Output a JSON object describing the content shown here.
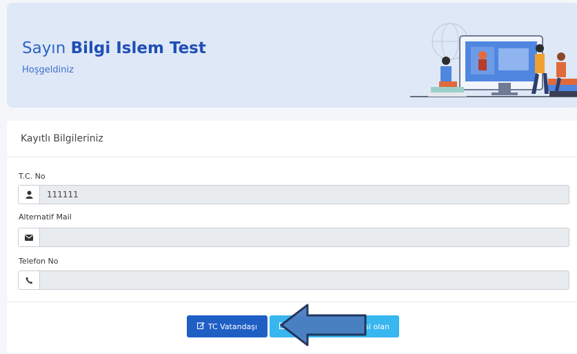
{
  "welcome": {
    "greeting_prefix": "Sayın",
    "user_name": "Bilgi Islem Test",
    "subtitle": "Hoşgeldiniz"
  },
  "card": {
    "title": "Kayıtlı Bilgileriniz",
    "fields": [
      {
        "label": "T.C. No",
        "value": "111111",
        "icon": "user-icon"
      },
      {
        "label": "Alternatif Mail",
        "value": "",
        "icon": "envelope-icon"
      },
      {
        "label": "Telefon No",
        "value": "",
        "icon": "phone-icon"
      }
    ]
  },
  "buttons": {
    "tc_label": "TC Vatandaşı",
    "other_label_visible": "si olan"
  },
  "colors": {
    "primary": "#1f5fc4",
    "info": "#38b6f0",
    "welcome_bg": "#dfe8f7",
    "arrow": "#4a7ec0"
  }
}
